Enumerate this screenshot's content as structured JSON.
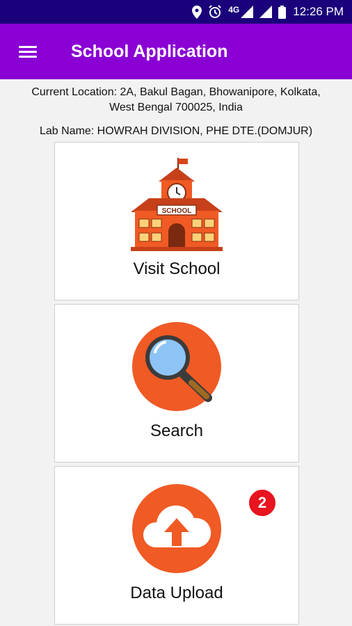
{
  "status_bar": {
    "network": "4G",
    "time": "12:26 PM",
    "icons": [
      "location-icon",
      "alarm-icon",
      "signal-icon",
      "signal-icon",
      "battery-icon"
    ]
  },
  "app_bar": {
    "title": "School Application",
    "menu_icon": "hamburger-menu-icon",
    "background": "#8a00d4"
  },
  "info": {
    "location_line1": "Current Location: 2A, Bakul Bagan, Bhowanipore, Kolkata,",
    "location_line2": "West Bengal 700025, India",
    "lab_name": "Lab Name: HOWRAH DIVISION, PHE DTE.(DOMJUR)"
  },
  "cards": [
    {
      "label": "Visit School",
      "icon": "school-building-icon",
      "sign_text": "SCHOOL"
    },
    {
      "label": "Search",
      "icon": "magnifier-icon"
    },
    {
      "label": "Data Upload",
      "icon": "cloud-upload-icon",
      "badge": "2"
    }
  ],
  "colors": {
    "accent": "#8a00d4",
    "status_bar": "#1a007a",
    "icon_orange": "#f05a24",
    "badge_red": "#e8141f"
  }
}
